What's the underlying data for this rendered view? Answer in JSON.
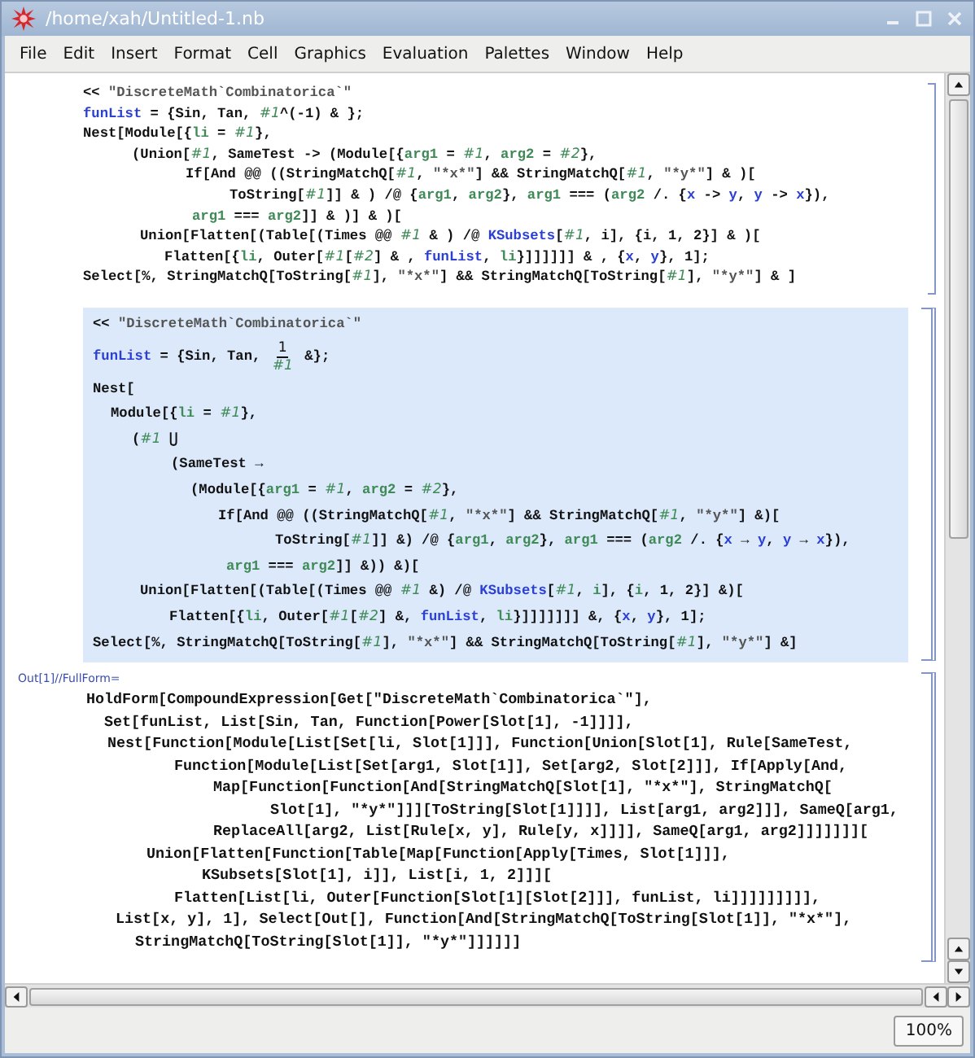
{
  "window": {
    "title": "/home/xah/Untitled-1.nb"
  },
  "menu": [
    "File",
    "Edit",
    "Insert",
    "Format",
    "Cell",
    "Graphics",
    "Evaluation",
    "Palettes",
    "Window",
    "Help"
  ],
  "input_cell": {
    "lines": [
      [
        {
          "kind": "plain",
          "text": "<< "
        },
        {
          "kind": "string",
          "text": "\"DiscreteMath`Combinatorica`\""
        }
      ],
      [
        {
          "kind": "global",
          "text": "funList"
        },
        {
          "kind": "plain",
          "text": " = {Sin, Tan, "
        },
        {
          "kind": "slot",
          "text": "#1"
        },
        {
          "kind": "plain",
          "text": "^(-1) & };"
        }
      ],
      [
        {
          "kind": "plain",
          "text": "Nest[Module[{"
        },
        {
          "kind": "local",
          "text": "li"
        },
        {
          "kind": "plain",
          "text": " = "
        },
        {
          "kind": "slot",
          "text": "#1"
        },
        {
          "kind": "plain",
          "text": "},"
        }
      ],
      [
        {
          "kind": "plain",
          "text": "(Union["
        },
        {
          "kind": "slot",
          "text": "#1"
        },
        {
          "kind": "plain",
          "text": ", SameTest -> (Module[{"
        },
        {
          "kind": "local",
          "text": "arg1"
        },
        {
          "kind": "plain",
          "text": " = "
        },
        {
          "kind": "slot",
          "text": "#1"
        },
        {
          "kind": "plain",
          "text": ", "
        },
        {
          "kind": "local",
          "text": "arg2"
        },
        {
          "kind": "plain",
          "text": " = "
        },
        {
          "kind": "slot",
          "text": "#2"
        },
        {
          "kind": "plain",
          "text": "},"
        }
      ],
      [
        {
          "kind": "plain",
          "text": "If[And @@ ((StringMatchQ["
        },
        {
          "kind": "slot",
          "text": "#1"
        },
        {
          "kind": "plain",
          "text": ", "
        },
        {
          "kind": "string",
          "text": "\"*x*\""
        },
        {
          "kind": "plain",
          "text": "] && StringMatchQ["
        },
        {
          "kind": "slot",
          "text": "#1"
        },
        {
          "kind": "plain",
          "text": ", "
        },
        {
          "kind": "string",
          "text": "\"*y*\""
        },
        {
          "kind": "plain",
          "text": "] & )["
        }
      ],
      [
        {
          "kind": "plain",
          "text": "ToString["
        },
        {
          "kind": "slot",
          "text": "#1"
        },
        {
          "kind": "plain",
          "text": "]] & ) /@ {"
        },
        {
          "kind": "local",
          "text": "arg1"
        },
        {
          "kind": "plain",
          "text": ", "
        },
        {
          "kind": "local",
          "text": "arg2"
        },
        {
          "kind": "plain",
          "text": "}, "
        },
        {
          "kind": "local",
          "text": "arg1"
        },
        {
          "kind": "plain",
          "text": " === ("
        },
        {
          "kind": "local",
          "text": "arg2"
        },
        {
          "kind": "plain",
          "text": " /. {"
        },
        {
          "kind": "global",
          "text": "x"
        },
        {
          "kind": "plain",
          "text": " -> "
        },
        {
          "kind": "global",
          "text": "y"
        },
        {
          "kind": "plain",
          "text": ", "
        },
        {
          "kind": "global",
          "text": "y"
        },
        {
          "kind": "plain",
          "text": " -> "
        },
        {
          "kind": "global",
          "text": "x"
        },
        {
          "kind": "plain",
          "text": "}),"
        }
      ],
      [
        {
          "kind": "local",
          "text": "arg1"
        },
        {
          "kind": "plain",
          "text": " === "
        },
        {
          "kind": "local",
          "text": "arg2"
        },
        {
          "kind": "plain",
          "text": "]] & )] & )["
        }
      ],
      [
        {
          "kind": "plain",
          "text": "Union[Flatten[(Table[(Times @@ "
        },
        {
          "kind": "slot",
          "text": "#1"
        },
        {
          "kind": "plain",
          "text": " & ) /@ "
        },
        {
          "kind": "global",
          "text": "KSubsets"
        },
        {
          "kind": "plain",
          "text": "["
        },
        {
          "kind": "slot",
          "text": "#1"
        },
        {
          "kind": "plain",
          "text": ", i], {i, 1, 2}] & )["
        }
      ],
      [
        {
          "kind": "plain",
          "text": "Flatten[{"
        },
        {
          "kind": "local",
          "text": "li"
        },
        {
          "kind": "plain",
          "text": ", Outer["
        },
        {
          "kind": "slot",
          "text": "#1"
        },
        {
          "kind": "plain",
          "text": "["
        },
        {
          "kind": "slot",
          "text": "#2"
        },
        {
          "kind": "plain",
          "text": "] & , "
        },
        {
          "kind": "global",
          "text": "funList"
        },
        {
          "kind": "plain",
          "text": ", "
        },
        {
          "kind": "local",
          "text": "li"
        },
        {
          "kind": "plain",
          "text": "}]]]]]] & , {"
        },
        {
          "kind": "global",
          "text": "x"
        },
        {
          "kind": "plain",
          "text": ", "
        },
        {
          "kind": "global",
          "text": "y"
        },
        {
          "kind": "plain",
          "text": "}, 1];"
        }
      ],
      [
        {
          "kind": "plain",
          "text": "Select[%, StringMatchQ[ToString["
        },
        {
          "kind": "slot",
          "text": "#1"
        },
        {
          "kind": "plain",
          "text": "], "
        },
        {
          "kind": "string",
          "text": "\"*x*\""
        },
        {
          "kind": "plain",
          "text": "] && StringMatchQ[ToString["
        },
        {
          "kind": "slot",
          "text": "#1"
        },
        {
          "kind": "plain",
          "text": "], "
        },
        {
          "kind": "string",
          "text": "\"*y*\""
        },
        {
          "kind": "plain",
          "text": "] & ]"
        }
      ]
    ]
  },
  "standard_form_cell": {
    "lines": [
      [
        {
          "kind": "plain",
          "text": "<< "
        },
        {
          "kind": "string",
          "text": "\"DiscreteMath`Combinatorica`\""
        }
      ],
      [
        {
          "kind": "global",
          "text": "funList"
        },
        {
          "kind": "plain",
          "text": " = {Sin, Tan, "
        },
        {
          "kind": "fraction",
          "numerator": "1",
          "denominator": "#1"
        },
        {
          "kind": "plain",
          "text": " &};"
        }
      ],
      [
        {
          "kind": "plain",
          "text": "Nest["
        }
      ],
      [
        {
          "kind": "plain",
          "text": "Module[{"
        },
        {
          "kind": "local",
          "text": "li"
        },
        {
          "kind": "plain",
          "text": " = "
        },
        {
          "kind": "slot",
          "text": "#1"
        },
        {
          "kind": "plain",
          "text": "},"
        }
      ],
      [
        {
          "kind": "plain",
          "text": "("
        },
        {
          "kind": "slot",
          "text": "#1"
        },
        {
          "kind": "plain",
          "text": " ⋃"
        }
      ],
      [
        {
          "kind": "plain",
          "text": "(SameTest →"
        }
      ],
      [
        {
          "kind": "plain",
          "text": "(Module[{"
        },
        {
          "kind": "local",
          "text": "arg1"
        },
        {
          "kind": "plain",
          "text": " = "
        },
        {
          "kind": "slot",
          "text": "#1"
        },
        {
          "kind": "plain",
          "text": ", "
        },
        {
          "kind": "local",
          "text": "arg2"
        },
        {
          "kind": "plain",
          "text": " = "
        },
        {
          "kind": "slot",
          "text": "#2"
        },
        {
          "kind": "plain",
          "text": "},"
        }
      ],
      [
        {
          "kind": "plain",
          "text": "If[And @@ ((StringMatchQ["
        },
        {
          "kind": "slot",
          "text": "#1"
        },
        {
          "kind": "plain",
          "text": ", "
        },
        {
          "kind": "string",
          "text": "\"*x*\""
        },
        {
          "kind": "plain",
          "text": "] && StringMatchQ["
        },
        {
          "kind": "slot",
          "text": "#1"
        },
        {
          "kind": "plain",
          "text": ", "
        },
        {
          "kind": "string",
          "text": "\"*y*\""
        },
        {
          "kind": "plain",
          "text": "] &)["
        }
      ],
      [
        {
          "kind": "plain",
          "text": "ToString["
        },
        {
          "kind": "slot",
          "text": "#1"
        },
        {
          "kind": "plain",
          "text": "]] &) /@ {"
        },
        {
          "kind": "local",
          "text": "arg1"
        },
        {
          "kind": "plain",
          "text": ", "
        },
        {
          "kind": "local",
          "text": "arg2"
        },
        {
          "kind": "plain",
          "text": "}, "
        },
        {
          "kind": "local",
          "text": "arg1"
        },
        {
          "kind": "plain",
          "text": " === ("
        },
        {
          "kind": "local",
          "text": "arg2"
        },
        {
          "kind": "plain",
          "text": " /. {"
        },
        {
          "kind": "global",
          "text": "x"
        },
        {
          "kind": "plain",
          "text": " → "
        },
        {
          "kind": "global",
          "text": "y"
        },
        {
          "kind": "plain",
          "text": ", "
        },
        {
          "kind": "global",
          "text": "y"
        },
        {
          "kind": "plain",
          "text": " → "
        },
        {
          "kind": "global",
          "text": "x"
        },
        {
          "kind": "plain",
          "text": "}),"
        }
      ],
      [
        {
          "kind": "local",
          "text": "arg1"
        },
        {
          "kind": "plain",
          "text": " === "
        },
        {
          "kind": "local",
          "text": "arg2"
        },
        {
          "kind": "plain",
          "text": "]] &)) &)["
        }
      ],
      [
        {
          "kind": "plain",
          "text": "Union[Flatten[(Table[(Times @@ "
        },
        {
          "kind": "slot",
          "text": "#1"
        },
        {
          "kind": "plain",
          "text": " &) /@ "
        },
        {
          "kind": "global",
          "text": "KSubsets"
        },
        {
          "kind": "plain",
          "text": "["
        },
        {
          "kind": "slot",
          "text": "#1"
        },
        {
          "kind": "plain",
          "text": ", "
        },
        {
          "kind": "local",
          "text": "i"
        },
        {
          "kind": "plain",
          "text": "], {"
        },
        {
          "kind": "local",
          "text": "i"
        },
        {
          "kind": "plain",
          "text": ", 1, 2}] &)["
        }
      ],
      [
        {
          "kind": "plain",
          "text": "Flatten[{"
        },
        {
          "kind": "local",
          "text": "li"
        },
        {
          "kind": "plain",
          "text": ", Outer["
        },
        {
          "kind": "slot",
          "text": "#1"
        },
        {
          "kind": "plain",
          "text": "["
        },
        {
          "kind": "slot",
          "text": "#2"
        },
        {
          "kind": "plain",
          "text": "] &, "
        },
        {
          "kind": "global",
          "text": "funList"
        },
        {
          "kind": "plain",
          "text": ", "
        },
        {
          "kind": "local",
          "text": "li"
        },
        {
          "kind": "plain",
          "text": "}]]]]]]] &, {"
        },
        {
          "kind": "global",
          "text": "x"
        },
        {
          "kind": "plain",
          "text": ", "
        },
        {
          "kind": "global",
          "text": "y"
        },
        {
          "kind": "plain",
          "text": "}, 1];"
        }
      ],
      [
        {
          "kind": "plain",
          "text": "Select[%, StringMatchQ[ToString["
        },
        {
          "kind": "slot",
          "text": "#1"
        },
        {
          "kind": "plain",
          "text": "], "
        },
        {
          "kind": "string",
          "text": "\"*x*\""
        },
        {
          "kind": "plain",
          "text": "] && StringMatchQ[ToString["
        },
        {
          "kind": "slot",
          "text": "#1"
        },
        {
          "kind": "plain",
          "text": "], "
        },
        {
          "kind": "string",
          "text": "\"*y*\""
        },
        {
          "kind": "plain",
          "text": "] &]"
        }
      ]
    ]
  },
  "output_cell": {
    "label": "Out[1]//FullForm=",
    "lines": [
      "HoldForm[CompoundExpression[Get[\"DiscreteMath`Combinatorica`\"],",
      "Set[funList, List[Sin, Tan, Function[Power[Slot[1], -1]]]],",
      "Nest[Function[Module[List[Set[li, Slot[1]]], Function[Union[Slot[1], Rule[SameTest,",
      "Function[Module[List[Set[arg1, Slot[1]], Set[arg2, Slot[2]]], If[Apply[And,",
      "Map[Function[Function[And[StringMatchQ[Slot[1], \"*x*\"], StringMatchQ[",
      "Slot[1], \"*y*\"]]][ToString[Slot[1]]]], List[arg1, arg2]]], SameQ[arg1,",
      "ReplaceAll[arg2, List[Rule[x, y], Rule[y, x]]]], SameQ[arg1, arg2]]]]]]][",
      "Union[Flatten[Function[Table[Map[Function[Apply[Times, Slot[1]]],",
      "KSubsets[Slot[1], i]], List[i, 1, 2]]][",
      "Flatten[List[li, Outer[Function[Slot[1][Slot[2]]], funList, li]]]]]]]]],",
      "List[x, y], 1], Select[Out[], Function[And[StringMatchQ[ToString[Slot[1]], \"*x*\"],",
      "StringMatchQ[ToString[Slot[1]], \"*y*\"]]]]]]"
    ]
  },
  "status_bar": {
    "zoom": "100%"
  }
}
